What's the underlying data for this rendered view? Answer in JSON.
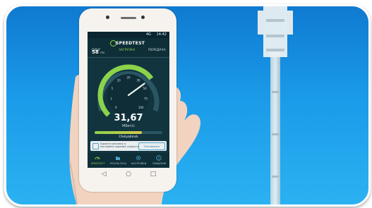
{
  "status": {
    "time": "14:42",
    "signal": "4G"
  },
  "app": {
    "brand": "SPEEDTEST"
  },
  "metrics": {
    "ping_label": "ПИНГ",
    "ping_value": "58",
    "ping_unit": "ms",
    "download_label": "ЗАГРУЗКА",
    "upload_label": "ПЕРЕДАЧА"
  },
  "gauge": {
    "speed": "31,67",
    "unit": "Мбит/с",
    "scale": [
      "0",
      "1",
      "5",
      "10",
      "20",
      "30",
      "50",
      "75",
      "100"
    ],
    "download_fraction": 0.7
  },
  "progress": {
    "label": "Chelyabinsk"
  },
  "promo": {
    "text": "Удалите рекламу и настройте задание скорости",
    "button": "Отключить"
  },
  "tabs": [
    {
      "label": "SPEEDTEST",
      "icon": "speedometer-icon",
      "active": true
    },
    {
      "label": "РЕЗУЛЬТАТЫ",
      "icon": "folder-icon",
      "active": false
    },
    {
      "label": "НАСТРОЙКИ",
      "icon": "gear-icon",
      "active": false
    },
    {
      "label": "СВЕДЕНИЯ",
      "icon": "info-icon",
      "active": false
    }
  ],
  "colors": {
    "sky": "#1a9ae8",
    "accent": "#8bd34b",
    "screen_bg": "#12343f",
    "phone_body": "#f6f3ef"
  }
}
